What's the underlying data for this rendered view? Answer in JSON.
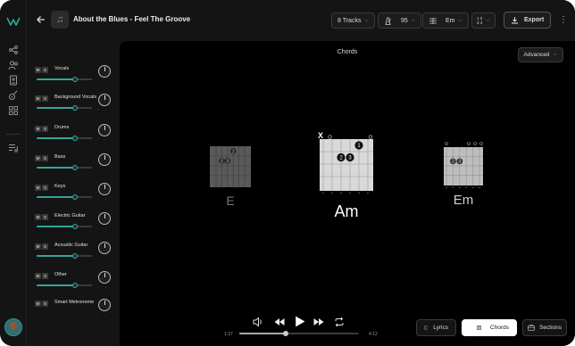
{
  "header": {
    "title": "About the Blues - Feel The Groove",
    "tracks_label": "8 Tracks",
    "tempo": "95",
    "key": "Em",
    "time_sig_top": "1 2",
    "time_sig_bottom": "3 4",
    "export_label": "Export"
  },
  "mixer": {
    "tracks": [
      {
        "name": "Vocals",
        "level": 0.7
      },
      {
        "name": "Background Vocals",
        "level": 0.7
      },
      {
        "name": "Drums",
        "level": 0.7
      },
      {
        "name": "Bass",
        "level": 0.7
      },
      {
        "name": "Keys",
        "level": 0.7
      },
      {
        "name": "Electric Guitar",
        "level": 0.7
      },
      {
        "name": "Acoustic Guitar",
        "level": 0.7
      },
      {
        "name": "Other",
        "level": 0.7
      },
      {
        "name": "Smart Metronome",
        "level": null
      }
    ],
    "mute_label": "M",
    "solo_label": "S"
  },
  "main": {
    "heading": "Chords",
    "advanced_label": "Advanced",
    "chords": [
      {
        "name": "E",
        "muted_marker": "",
        "state": "previous",
        "fingers": [
          "1",
          "2",
          "3"
        ]
      },
      {
        "name": "Am",
        "muted_marker": "X",
        "state": "current",
        "fingers": [
          "1",
          "2",
          "3"
        ]
      },
      {
        "name": "Em",
        "muted_marker": "",
        "state": "next",
        "fingers": [
          "2",
          "3"
        ]
      }
    ]
  },
  "transport": {
    "elapsed": "1:37",
    "total": "4:12",
    "progress": 0.39
  },
  "view_buttons": {
    "lyrics": "Lyrics",
    "chords": "Chords",
    "sections": "Sections",
    "active": "chords"
  },
  "colors": {
    "accent": "#2fa89a",
    "background": "#000000",
    "panel": "#141414"
  }
}
